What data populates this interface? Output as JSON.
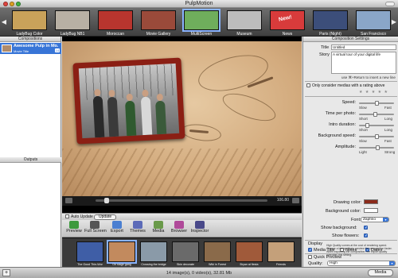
{
  "window": {
    "title": "PulpMotion"
  },
  "themes": [
    {
      "label": "LadyBug Color",
      "color": "#c9a25a"
    },
    {
      "label": "LadyBug NB1",
      "color": "#b8b0a4"
    },
    {
      "label": "Moroccan",
      "color": "#b8352e"
    },
    {
      "label": "Movie Gallery",
      "color": "#9a4a3a"
    },
    {
      "label": "MultiScreen",
      "color": "#6fae5c"
    },
    {
      "label": "Museum",
      "color": "#bdbdbd"
    },
    {
      "label": "News",
      "color": "#d83b3b",
      "badge": "New!"
    },
    {
      "label": "Paris (Night)",
      "color": "#3c4e7a"
    },
    {
      "label": "San Francisco",
      "color": "#8aa6c8"
    }
  ],
  "compositions": {
    "header": "Compositions",
    "items": [
      {
        "title": "Awesome Pulp in Mo...",
        "subtitle": "Movie Title",
        "badge": "14"
      }
    ]
  },
  "outputs": {
    "header": "Outputs"
  },
  "preview": {
    "time_display": "106.80",
    "progress": 0.05
  },
  "under_bar": {
    "auto_update": "Auto Update",
    "update_button": "Update"
  },
  "toolbar": {
    "items": [
      {
        "label": "Preview",
        "icon": "play-icon",
        "color": "#3e9a3e"
      },
      {
        "label": "Full Screen",
        "icon": "fullscreen-icon",
        "color": "#555555"
      },
      {
        "label": "Export",
        "icon": "export-icon",
        "color": "#4a7fd1"
      },
      {
        "label": "Themes",
        "icon": "themes-icon",
        "color": "#5c6bb8"
      },
      {
        "label": "Media",
        "icon": "media-icon",
        "color": "#6a9a4a"
      },
      {
        "label": "Browser",
        "icon": "browser-icon",
        "color": "#b04a9a"
      },
      {
        "label": "Inspector",
        "icon": "inspector-icon",
        "color": "#4a4a8a"
      }
    ]
  },
  "media": {
    "items": [
      {
        "caption": "The Good Thin-Wor",
        "color": "#3f5ea6"
      },
      {
        "caption": "On stage gang",
        "color": "#c28a5e"
      },
      {
        "caption": "Crossing the bridge",
        "color": "#8a9aa8"
      },
      {
        "caption": "Skin decorate",
        "color": "#6a6a6a"
      },
      {
        "caption": "Wiki in Forest",
        "color": "#8a6a4a"
      },
      {
        "caption": "Bryan at fiesta",
        "color": "#a05a3a"
      },
      {
        "caption": "Friends",
        "color": "#c4a07a"
      }
    ]
  },
  "settings": {
    "header": "Composition Settings",
    "title_label": "Title",
    "title_value": "Untitled",
    "story_label": "Story",
    "story_value": "A virtual tour of your digital life",
    "story_hint": "use ⌘+Return to insert a new line",
    "rating_label": "Only consider medias with a rating above",
    "rating_stars": "★ ★ ★ ★ ★",
    "speed": {
      "label": "Speed:",
      "min": "Slow",
      "max": "Fast",
      "value": 0.5
    },
    "time_per_photo": {
      "label": "Time per photo:",
      "min": "Short",
      "max": "Long",
      "value": 0.45
    },
    "intro_duration": {
      "label": "Intro duration:",
      "min": "Short",
      "max": "Long",
      "value": 0.2
    },
    "background_speed": {
      "label": "Background speed:",
      "min": "Slow",
      "max": "Fast",
      "value": 0.5
    },
    "amplitude": {
      "label": "Amplitude:",
      "min": "Light",
      "max": "Strong",
      "value": 0.55
    },
    "drawing_color_label": "Drawing color:",
    "drawing_color": "#8b2a1a",
    "background_color_label": "Background color:",
    "background_color": "#ffffff",
    "font_label": "Font:",
    "font_value": "Zapfino",
    "show_background_label": "Show background:",
    "show_flowers_label": "Show flowers:",
    "display_header": "Display",
    "display_media_title": "Media Title",
    "display_notes": "Notes",
    "display_dates": "Dates",
    "quick_preview": "Quick Preview",
    "quality_label": "Quality:",
    "quality_value": "High",
    "quality_note": "High Quality comes at the cost of rendering speed. Choose a low quality to preview the composition faster. When exporting the composition, the export quality overrides this setting."
  },
  "status": {
    "text": "14 image(s), 0 video(s), 32.81 Mb",
    "media_button": "Media",
    "add_button": "+"
  }
}
